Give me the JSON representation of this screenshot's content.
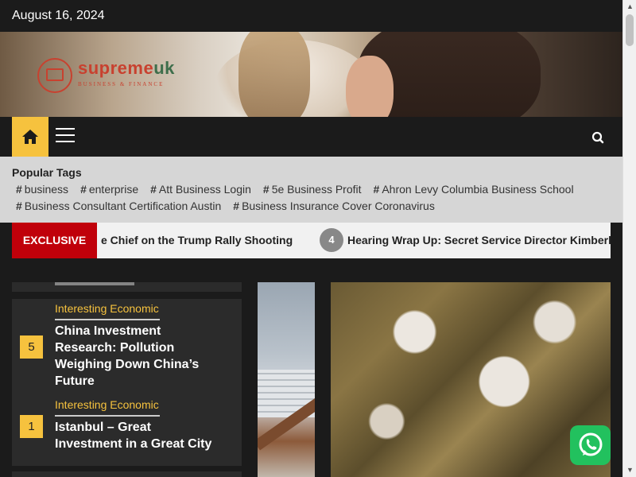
{
  "topbar": {
    "date": "August 16, 2024"
  },
  "brand": {
    "name_a": "supreme",
    "name_b": "uk",
    "tagline": "BUSINESS & FINANCE"
  },
  "nav": {
    "home_icon": "home-icon",
    "menu_icon": "hamburger-menu-icon",
    "search_icon": "search-icon"
  },
  "popular_tags": {
    "title": "Popular Tags",
    "items": [
      "business",
      "enterprise",
      "Att Business Login",
      "5e Business Profit",
      "Ahron Levy Columbia Business School",
      "Business Consultant Certification Austin",
      "Business Insurance Cover Coronavirus"
    ]
  },
  "ticker": {
    "label": "EXCLUSIVE",
    "item1": "e Chief on the Trump Rally Shooting",
    "item2_number": "4",
    "item2": "Hearing Wrap Up: Secret Service Director Kimberly C"
  },
  "sidebar": {
    "items": [
      {
        "number": "5",
        "category": "Interesting Economic",
        "title": "China Investment Research: Pollution Weighing Down China’s Future"
      },
      {
        "number": "1",
        "category": "Interesting Economic",
        "title": "Istanbul – Great Investment in a Great City"
      }
    ]
  },
  "colors": {
    "accent": "#f6c23e",
    "exclusive": "#c0000a",
    "brand_red": "#c8412f",
    "brand_green": "#3e6e4b",
    "whatsapp": "#22c15e"
  },
  "floating": {
    "whatsapp_icon": "whatsapp-icon"
  }
}
